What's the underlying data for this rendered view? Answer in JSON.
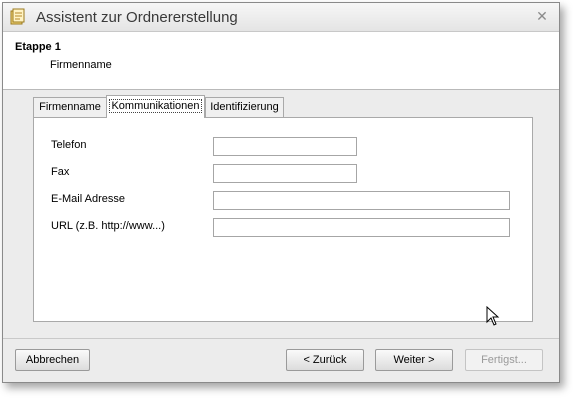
{
  "window": {
    "title": "Assistent zur Ordnererstellung",
    "close_glyph": "✕"
  },
  "header": {
    "step_title": "Etappe 1",
    "step_subtitle": "Firmenname"
  },
  "tabs": [
    {
      "label": "Firmenname",
      "active": false
    },
    {
      "label": "Kommunikationen",
      "active": true
    },
    {
      "label": "Identifizierung",
      "active": false
    }
  ],
  "fields": {
    "telefon": {
      "label": "Telefon",
      "value": ""
    },
    "fax": {
      "label": "Fax",
      "value": ""
    },
    "email": {
      "label": "E-Mail Adresse",
      "value": ""
    },
    "url": {
      "label": "URL (z.B. http://www...)",
      "value": ""
    }
  },
  "buttons": {
    "cancel": "Abbrechen",
    "back": "< Zurück",
    "next": "Weiter >",
    "finish": "Fertigst..."
  },
  "icons": {
    "app": "folder-wizard-icon",
    "close": "close-icon",
    "cursor": "mouse-pointer-icon"
  }
}
